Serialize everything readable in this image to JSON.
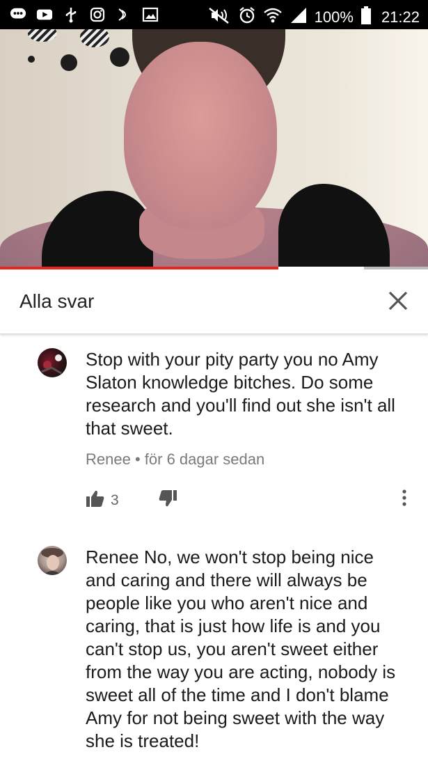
{
  "status_bar": {
    "battery": "100%",
    "time": "21:22",
    "icons_left": [
      "chat-icon",
      "youtube-icon",
      "usb-icon",
      "instagram-icon",
      "nfc-icon",
      "image-icon"
    ],
    "icons_right": [
      "mute-icon",
      "alarm-icon",
      "wifi-icon",
      "signal-icon",
      "battery-icon"
    ]
  },
  "video": {
    "progress_played": 0.65,
    "progress_buffered": 0.85
  },
  "panel": {
    "title": "Alla svar",
    "close_icon": "close-icon"
  },
  "comments": [
    {
      "text": "Stop with your pity party you no Amy Slaton knowledge bitches. Do some research and you'll find out she isn't all that sweet.",
      "author": "Renee",
      "separator": "•",
      "time": "för 6 dagar sedan",
      "likes": "3"
    },
    {
      "text": "Renee No, we won't stop being nice and caring and there will always be people like you who aren't nice and caring, that is just how life is and you can't stop us, you aren't sweet either from the way you are acting, nobody is sweet all of the time and I don't blame Amy for not being sweet with the way she is treated!"
    }
  ],
  "colors": {
    "accent_red": "#e5261f",
    "status_bar": "#000000",
    "meta_gray": "#7a7a7a"
  }
}
